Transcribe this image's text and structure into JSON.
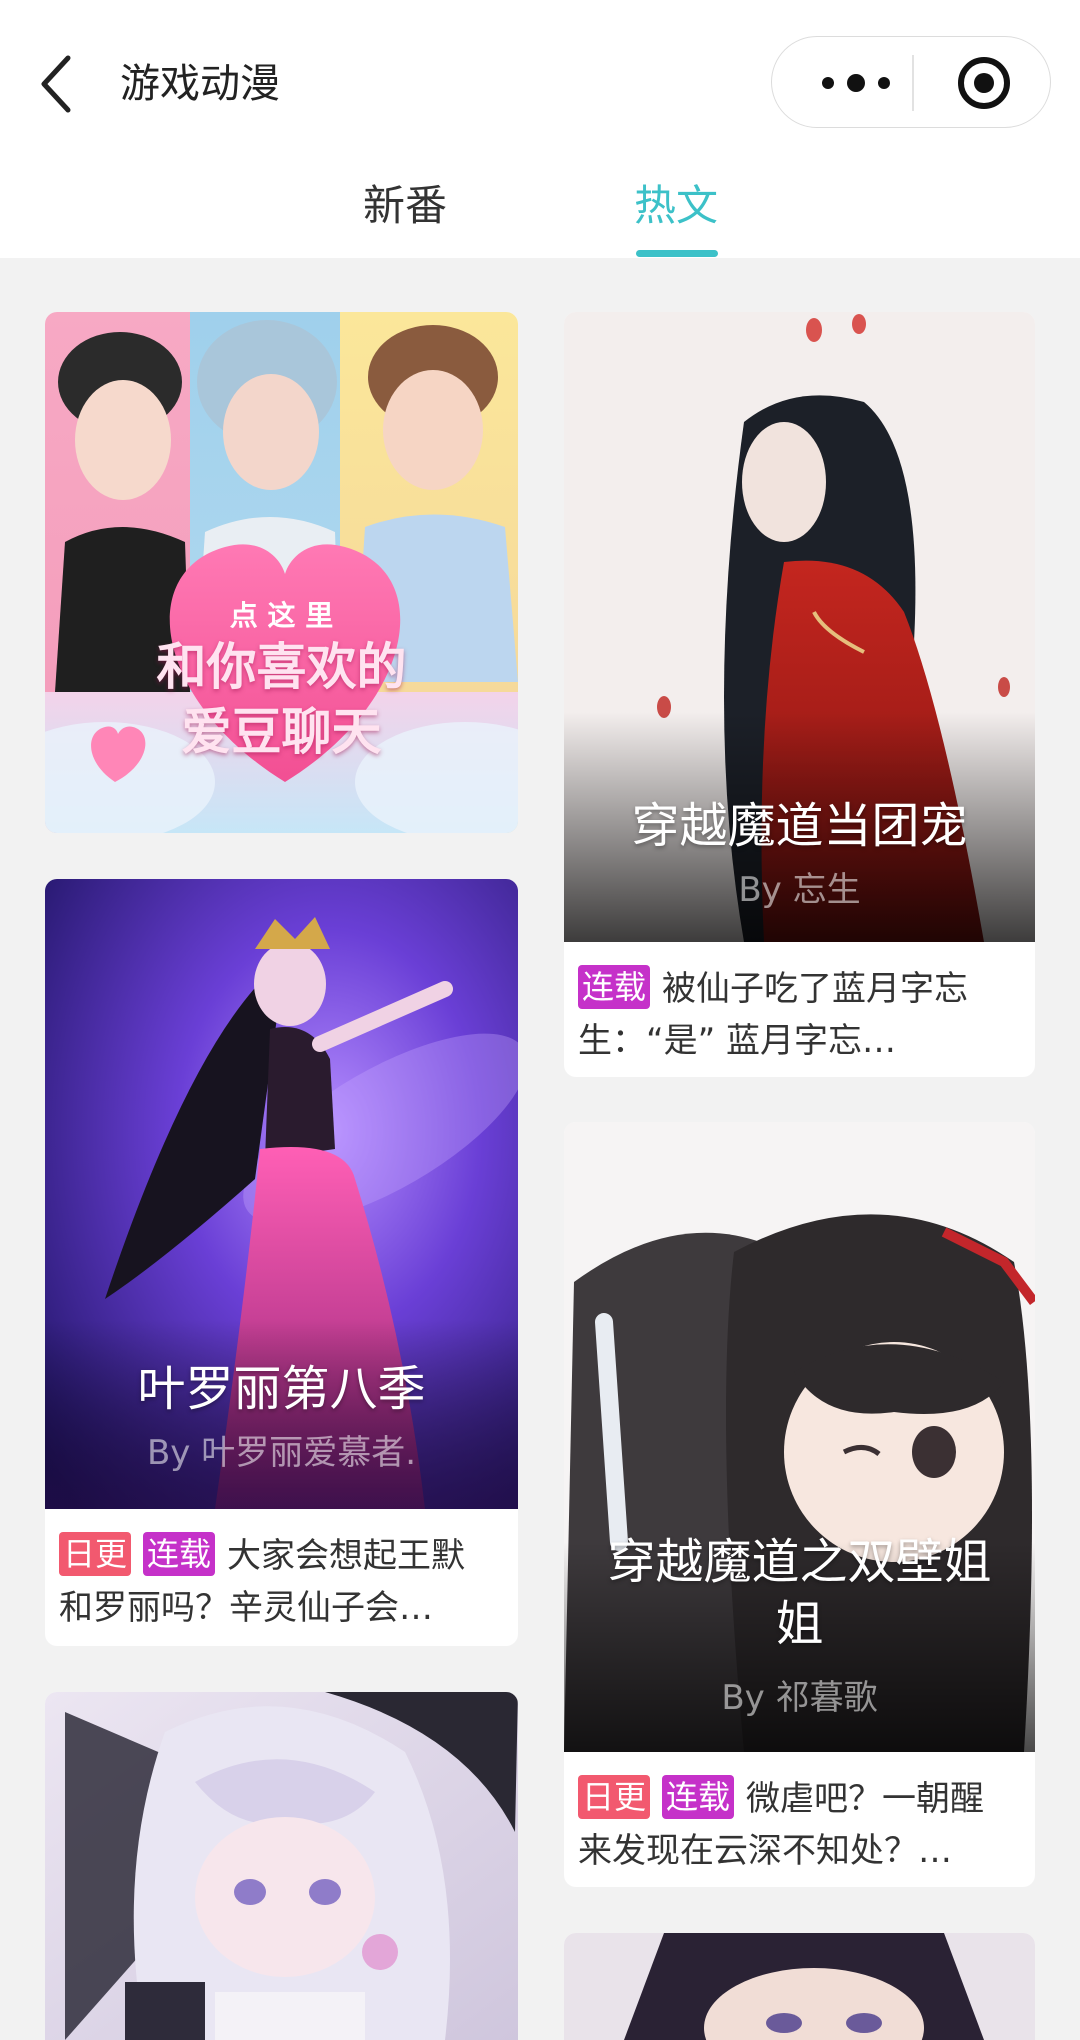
{
  "header": {
    "title": "游戏动漫",
    "tabs": [
      {
        "label": "新番",
        "active": false
      },
      {
        "label": "热文",
        "active": true
      }
    ]
  },
  "colors": {
    "accent": "#3cc1c8",
    "tag_daily": "#f2596f",
    "tag_serial": "#c531c9"
  },
  "banner": {
    "line1": "点 这 里",
    "line2": "和你喜欢的",
    "line3": "爱豆聊天"
  },
  "cards": [
    {
      "title": "叶罗丽第八季",
      "author": "By 叶罗丽爱慕者.",
      "tags": [
        "日更",
        "连载"
      ],
      "desc_line1": "大家会想起王默",
      "desc_line2": "和罗丽吗？辛灵仙子会…"
    },
    {
      "title": "穿越魔道当团宠",
      "author": "By 忘生",
      "tags": [
        "连载"
      ],
      "desc_line1": "被仙子吃了蓝月字忘",
      "desc_line2": "生：“是” 蓝月字忘…"
    },
    {
      "title_line1": "穿越魔道之双壁姐",
      "title_line2": "姐",
      "author": "By 祁暮歌",
      "tags": [
        "日更",
        "连载"
      ],
      "desc_line1": "微虐吧？一朝醒",
      "desc_line2": "来发现在云深不知处？…"
    }
  ]
}
